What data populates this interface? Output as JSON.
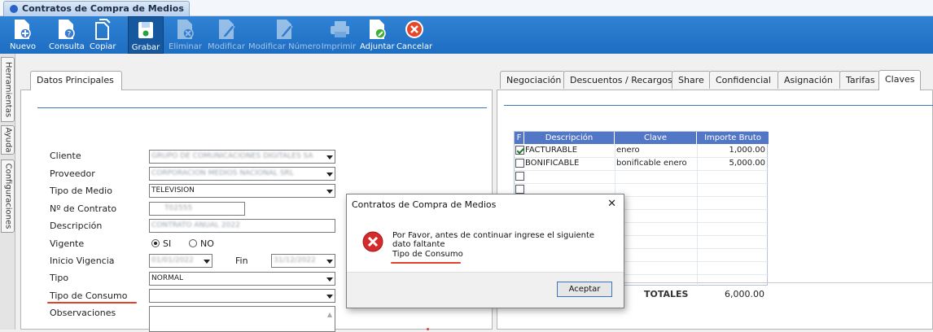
{
  "window": {
    "tab_title": "Contratos de Compra de Medios"
  },
  "toolbar": {
    "buttons": [
      {
        "label": "Nuevo",
        "icon": "new-doc-icon",
        "enabled": true
      },
      {
        "label": "Consulta",
        "icon": "query-doc-icon",
        "enabled": true
      },
      {
        "label": "Copiar",
        "icon": "copy-icon",
        "enabled": true
      },
      {
        "label": "Grabar",
        "icon": "save-icon",
        "enabled": true,
        "active": true
      },
      {
        "label": "Eliminar",
        "icon": "delete-doc-icon",
        "enabled": true
      },
      {
        "label": "Modificar",
        "icon": "edit-doc-icon",
        "enabled": true
      },
      {
        "label": "Modificar Número",
        "icon": "edit-number-icon",
        "enabled": true
      },
      {
        "label": "Imprimir",
        "icon": "printer-icon",
        "enabled": true
      },
      {
        "label": "Adjuntar",
        "icon": "attach-icon",
        "enabled": true
      },
      {
        "label": "Cancelar",
        "icon": "cancel-icon",
        "enabled": true
      }
    ]
  },
  "sidebar": {
    "tabs": [
      "Herramientas",
      "Ayuda",
      "Configuraciones"
    ]
  },
  "left": {
    "tab": "Datos Principales",
    "fields": {
      "cliente": {
        "label": "Cliente",
        "value": "GRUPO DE COMUNICACIONES DIGITALES SA"
      },
      "proveedor": {
        "label": "Proveedor",
        "value": "CORPORACION MEDIOS NACIONAL SRL"
      },
      "tipo_medio": {
        "label": "Tipo de Medio",
        "value": "TELEVISION"
      },
      "contrato": {
        "label": "Nº de Contrato",
        "value": "T02555"
      },
      "descripcion": {
        "label": "Descripción",
        "value": "CONTRATO ANUAL 2022"
      },
      "vigente": {
        "label": "Vigente",
        "opt_si": "SI",
        "opt_no": "NO",
        "selected": "SI"
      },
      "inicio": {
        "label": "Inicio Vigencia",
        "value": "01/01/2022",
        "fin_label": "Fin",
        "fin_value": "31/12/2022"
      },
      "tipo": {
        "label": "Tipo",
        "value": "NORMAL"
      },
      "tipo_consumo": {
        "label": "Tipo de Consumo",
        "value": ""
      },
      "observaciones": {
        "label": "Observaciones",
        "value": ""
      }
    }
  },
  "right": {
    "tabs": [
      "Negociación",
      "Descuentos / Recargos",
      "Share",
      "Confidencial",
      "Asignación",
      "Tarifas",
      "Claves"
    ],
    "active_tab": "Claves",
    "grid": {
      "headers": [
        "F",
        "Descripción",
        "Clave",
        "Importe Bruto"
      ],
      "rows": [
        {
          "checked": true,
          "descripcion": "FACTURABLE",
          "clave": "enero",
          "importe": "1,000.00"
        },
        {
          "checked": false,
          "descripcion": "BONIFICABLE",
          "clave": "bonificable enero",
          "importe": "5,000.00"
        },
        {
          "checked": false,
          "descripcion": "",
          "clave": "",
          "importe": ""
        },
        {
          "checked": false,
          "descripcion": "",
          "clave": "",
          "importe": ""
        }
      ]
    },
    "totals": {
      "label": "TOTALES",
      "value": "6,000.00"
    }
  },
  "dialog": {
    "title": "Contratos de Compra de Medios",
    "close": "✕",
    "message": "Por Favor, antes de continuar ingrese el siguiente dato faltante",
    "field": "Tipo de Consumo",
    "ok": "Aceptar"
  },
  "colors": {
    "toolbar": "#1e6ec3",
    "accent": "#2a63c6",
    "error": "#d62b2b",
    "highlight": "#e0412a",
    "grid_header": "#5377c7"
  }
}
